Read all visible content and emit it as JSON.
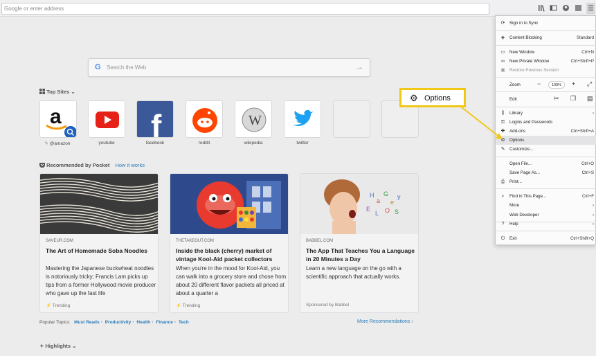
{
  "browser": {
    "address_placeholder": "Google or enter address"
  },
  "search": {
    "g_letter": "G",
    "placeholder": "Search the Web",
    "arrow": "→"
  },
  "top_sites": {
    "title": "Top Sites",
    "tiles": [
      {
        "label": "@amazon"
      },
      {
        "label": "youtube"
      },
      {
        "label": "facebook"
      },
      {
        "label": "reddit"
      },
      {
        "label": "wikipedia"
      },
      {
        "label": "twitter"
      }
    ]
  },
  "pocket": {
    "title": "Recommended by Pocket",
    "how_it_works": "How it works",
    "cards": [
      {
        "source": "SAVEUR.COM",
        "title": "The Art of Homemade Soba Noodles",
        "description": "Mastering the Japanese buckwheat noodles is notoriously tricky; Francis Lam picks up tips from a former Hollywood movie producer who gave up the fast life",
        "footer": "Trending"
      },
      {
        "source": "THETAKEOUT.COM",
        "title": "Inside the black (cherry) market of vintage Kool-Aid packet collectors",
        "description": "When you're in the mood for Kool-Aid, you can walk into a grocery store and chose from about 20 different flavor packets all priced at about a quarter a",
        "footer": "Trending"
      },
      {
        "source": "BABBEL.COM",
        "title": "The App That Teaches You a Language in 20 Minutes a Day",
        "description": "Learn a new language on the go with a scientific approach that actually works.",
        "footer": "Sponsored by Babbel"
      }
    ],
    "popular_topics_label": "Popular Topics:",
    "topics": [
      "Must Reads",
      "Productivity",
      "Health",
      "Finance",
      "Tech"
    ],
    "more_recommendations": "More Recommendations"
  },
  "highlights": {
    "title": "Highlights"
  },
  "menu": {
    "sign_in": "Sign in to Sync",
    "content_blocking": "Content Blocking",
    "content_blocking_value": "Standard",
    "new_window": "New Window",
    "new_window_sc": "Ctrl+N",
    "new_private": "New Private Window",
    "new_private_sc": "Ctrl+Shift+P",
    "restore": "Restore Previous Session",
    "zoom": "Zoom",
    "zoom_minus": "−",
    "zoom_value": "100%",
    "zoom_plus": "+",
    "edit": "Edit",
    "library": "Library",
    "logins": "Logins and Passwords",
    "addons": "Add-ons",
    "addons_sc": "Ctrl+Shift+A",
    "options": "Options",
    "customize": "Customize...",
    "open_file": "Open File...",
    "open_file_sc": "Ctrl+O",
    "save_page": "Save Page As...",
    "save_page_sc": "Ctrl+S",
    "print": "Print...",
    "find": "Find in This Page...",
    "find_sc": "Ctrl+F",
    "more": "More",
    "web_dev": "Web Developer",
    "help": "Help",
    "exit": "Exit",
    "exit_sc": "Ctrl+Shift+Q"
  },
  "callout": {
    "label": "Options"
  },
  "colors": {
    "accent_link": "#2b7cb5",
    "callout_border": "#f2c816"
  }
}
